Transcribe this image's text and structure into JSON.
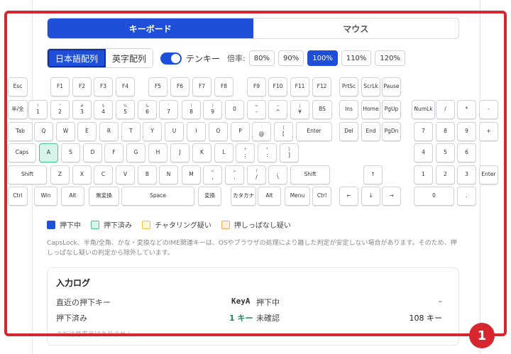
{
  "tabs": [
    {
      "label": "キーボード",
      "active": true
    },
    {
      "label": "マウス",
      "active": false
    }
  ],
  "layout_buttons": [
    {
      "label": "日本語配列",
      "active": true
    },
    {
      "label": "英字配列",
      "active": false
    }
  ],
  "tenkey_label": "テンキー",
  "tenkey_enabled": true,
  "zoom_label": "倍率:",
  "zoom_options": [
    {
      "label": "80%",
      "active": false
    },
    {
      "label": "90%",
      "active": false
    },
    {
      "label": "100%",
      "active": true
    },
    {
      "label": "110%",
      "active": false
    },
    {
      "label": "120%",
      "active": false
    }
  ],
  "keyboard": {
    "rows": [
      [
        {
          "label": "Esc"
        },
        {
          "label": "F1"
        },
        {
          "label": "F2"
        },
        {
          "label": "F3"
        },
        {
          "label": "F4"
        },
        {
          "label": "F5"
        },
        {
          "label": "F6"
        },
        {
          "label": "F7"
        },
        {
          "label": "F8"
        },
        {
          "label": "F9"
        },
        {
          "label": "F10"
        },
        {
          "label": "F11"
        },
        {
          "label": "F12"
        },
        {
          "label": "PrtSc"
        },
        {
          "label": "ScrLk"
        },
        {
          "label": "Pause"
        }
      ],
      [
        {
          "label": "半/全"
        },
        {
          "label": "1",
          "sub": "!"
        },
        {
          "label": "2",
          "sub": "\""
        },
        {
          "label": "3",
          "sub": "#"
        },
        {
          "label": "4",
          "sub": "$"
        },
        {
          "label": "5",
          "sub": "%"
        },
        {
          "label": "6",
          "sub": "&"
        },
        {
          "label": "7",
          "sub": "'"
        },
        {
          "label": "8",
          "sub": "("
        },
        {
          "label": "9",
          "sub": ")"
        },
        {
          "label": "0"
        },
        {
          "label": "-",
          "sub": "="
        },
        {
          "label": "^",
          "sub": "~"
        },
        {
          "label": "¥",
          "sub": "|"
        },
        {
          "label": "BS"
        },
        {
          "label": "Ins"
        },
        {
          "label": "Home"
        },
        {
          "label": "PgUp"
        },
        {
          "label": "NumLk"
        },
        {
          "label": "/"
        },
        {
          "label": "*"
        },
        {
          "label": "-"
        }
      ],
      [
        {
          "label": "Tab"
        },
        {
          "label": "Q"
        },
        {
          "label": "W"
        },
        {
          "label": "E"
        },
        {
          "label": "R"
        },
        {
          "label": "T"
        },
        {
          "label": "Y"
        },
        {
          "label": "U"
        },
        {
          "label": "I"
        },
        {
          "label": "O"
        },
        {
          "label": "P"
        },
        {
          "label": "@",
          "sub": "`"
        },
        {
          "label": "[",
          "sub": "{"
        },
        {
          "label": "Enter"
        },
        {
          "label": "Del"
        },
        {
          "label": "End"
        },
        {
          "label": "PgDn"
        },
        {
          "label": "7"
        },
        {
          "label": "8"
        },
        {
          "label": "9"
        },
        {
          "label": "+"
        }
      ],
      [
        {
          "label": "Caps"
        },
        {
          "label": "A",
          "state": "done"
        },
        {
          "label": "S"
        },
        {
          "label": "D"
        },
        {
          "label": "F"
        },
        {
          "label": "G"
        },
        {
          "label": "H"
        },
        {
          "label": "J"
        },
        {
          "label": "K"
        },
        {
          "label": "L"
        },
        {
          "label": ";",
          "sub": "+"
        },
        {
          "label": ":",
          "sub": "*"
        },
        {
          "label": "]",
          "sub": "}"
        },
        {
          "label": "4"
        },
        {
          "label": "5"
        },
        {
          "label": "6"
        }
      ],
      [
        {
          "label": "Shift"
        },
        {
          "label": "Z"
        },
        {
          "label": "X"
        },
        {
          "label": "C"
        },
        {
          "label": "V"
        },
        {
          "label": "B"
        },
        {
          "label": "N"
        },
        {
          "label": "M"
        },
        {
          "label": ",",
          "sub": "<"
        },
        {
          "label": ".",
          "sub": ">"
        },
        {
          "label": "/",
          "sub": "?"
        },
        {
          "label": "\\",
          "sub": "_"
        },
        {
          "label": "Shift"
        },
        {
          "label": "↑"
        },
        {
          "label": "1"
        },
        {
          "label": "2"
        },
        {
          "label": "3"
        },
        {
          "label": "Enter"
        }
      ],
      [
        {
          "label": "Ctrl"
        },
        {
          "label": "Win"
        },
        {
          "label": "Alt"
        },
        {
          "label": "無変換"
        },
        {
          "label": "Space"
        },
        {
          "label": "変換"
        },
        {
          "label": "カタカナ"
        },
        {
          "label": "Alt"
        },
        {
          "label": "Menu"
        },
        {
          "label": "Ctrl"
        },
        {
          "label": "←"
        },
        {
          "label": "↓"
        },
        {
          "label": "→"
        },
        {
          "label": "0"
        },
        {
          "label": "."
        }
      ]
    ]
  },
  "legend": [
    {
      "label": "押下中",
      "fill": "#1f4fd8",
      "border": "#1f4fd8"
    },
    {
      "label": "押下済み",
      "fill": "#d6f5e8",
      "border": "#4cc291"
    },
    {
      "label": "チャタリング疑い",
      "fill": "#fff6d6",
      "border": "#e8c04a"
    },
    {
      "label": "押しっぱなし疑い",
      "fill": "#ffeedd",
      "border": "#f0a65a"
    }
  ],
  "note": "CapsLock、半角/全角、かな・変換などのIME関連キーは、OSやブラウザの処理により離した判定が安定しない場合があります。そのため、押しっぱなし疑いの判定から除外しています。",
  "log": {
    "title": "入力ログ",
    "recent_label": "直近の押下キー",
    "recent_value": "KeyA",
    "pressing_label": "押下中",
    "pressing_value": "–",
    "done_label": "押下済み",
    "done_value": "1 キー",
    "unconfirmed_label": "未確認",
    "unconfirmed_value": "108 キー",
    "empty_text": "まだ注意表示はありません。"
  },
  "callout_number": "1",
  "colors": {
    "accent": "#1f4fd8",
    "callout": "#d7262d",
    "done_green": "#1a8a5a"
  }
}
